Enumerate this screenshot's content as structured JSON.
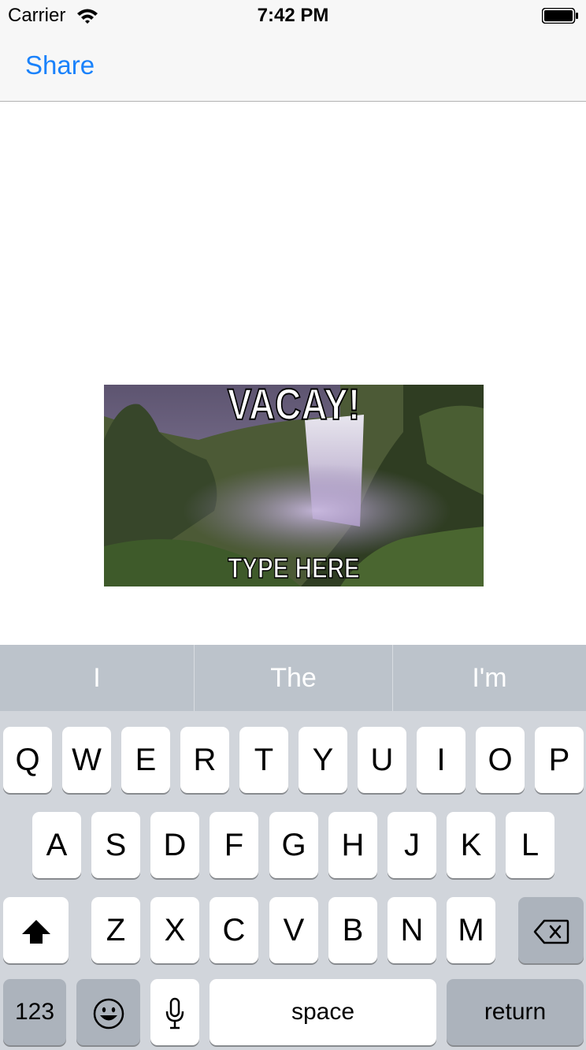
{
  "status_bar": {
    "carrier": "Carrier",
    "time": "7:42 PM",
    "icons": [
      "wifi-icon",
      "battery-icon"
    ]
  },
  "nav": {
    "share_label": "Share",
    "accent": "#1a82fb"
  },
  "meme": {
    "top_text": "VACAY!",
    "bottom_text": "TYPE HERE"
  },
  "keyboard": {
    "suggestions": [
      "I",
      "The",
      "I'm"
    ],
    "row1": [
      "Q",
      "W",
      "E",
      "R",
      "T",
      "Y",
      "U",
      "I",
      "O",
      "P"
    ],
    "row2": [
      "A",
      "S",
      "D",
      "F",
      "G",
      "H",
      "J",
      "K",
      "L"
    ],
    "row3": [
      "Z",
      "X",
      "C",
      "V",
      "B",
      "N",
      "M"
    ],
    "bottom": {
      "numbers": "123",
      "space": "space",
      "return": "return"
    },
    "icons": [
      "shift-icon",
      "backspace-icon",
      "emoji-icon",
      "microphone-icon"
    ]
  }
}
